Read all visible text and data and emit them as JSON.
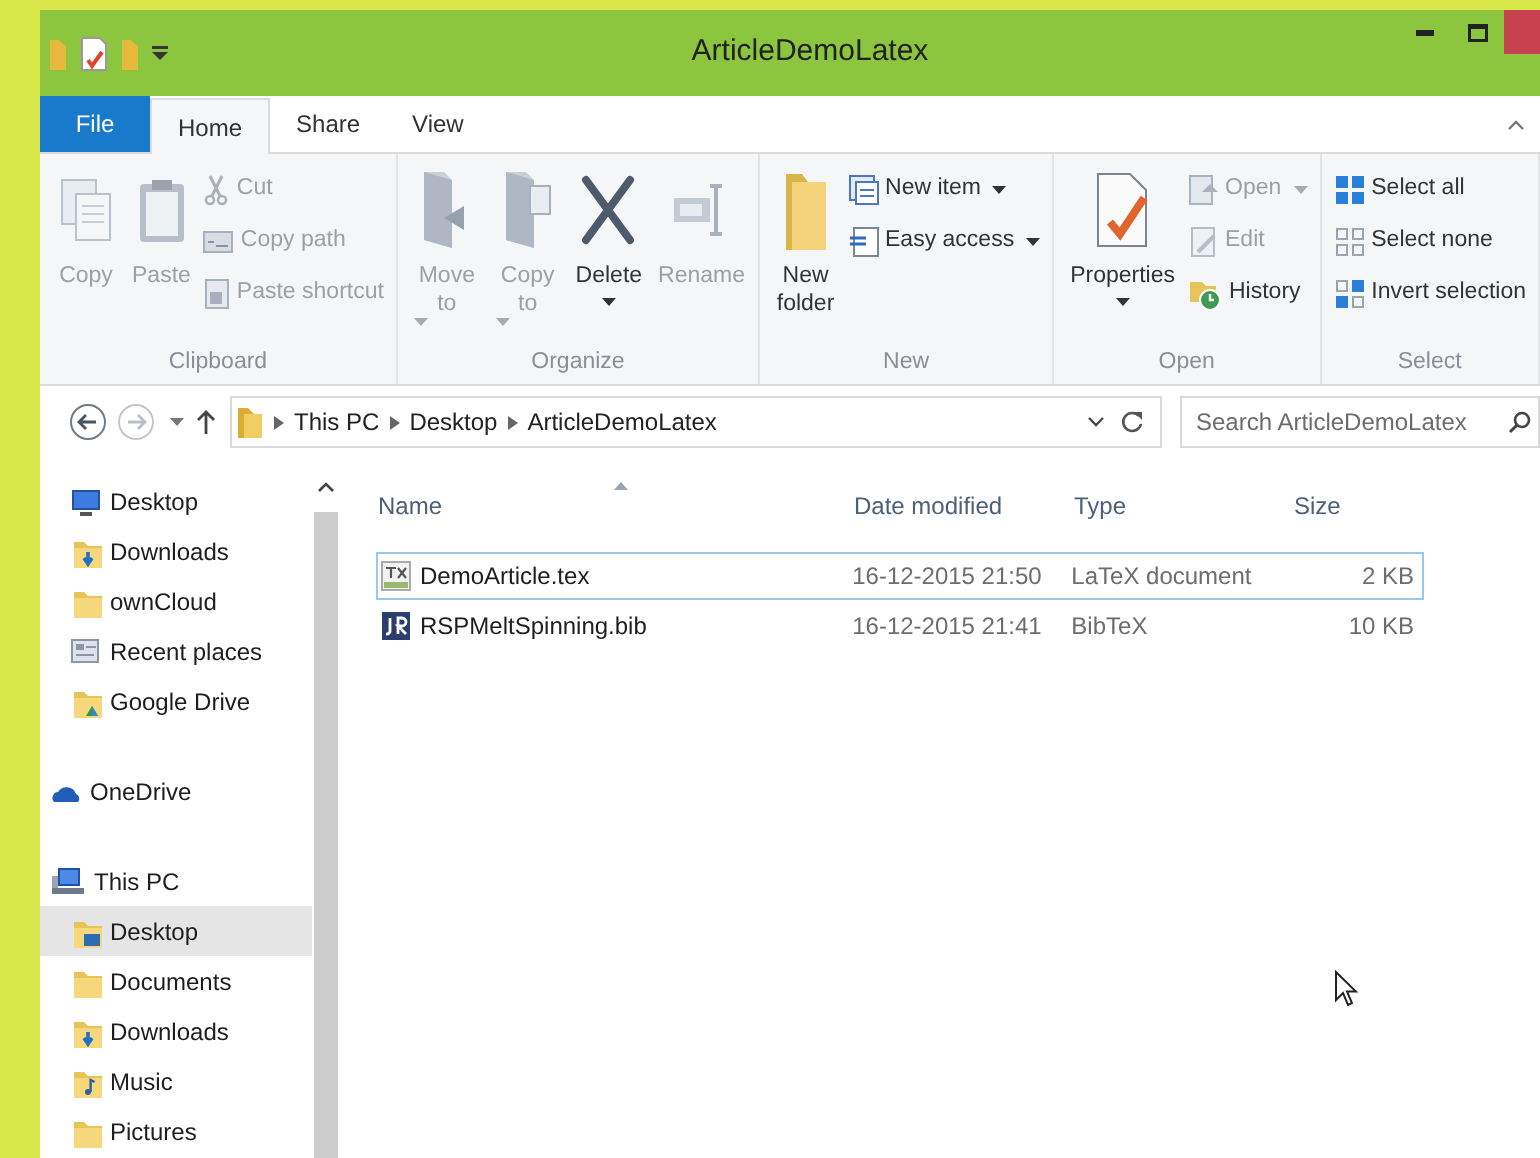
{
  "window": {
    "title": "ArticleDemoLatex"
  },
  "ribbon_tabs": [
    {
      "label": "File",
      "kind": "file",
      "selected": false
    },
    {
      "label": "Home",
      "kind": "tab",
      "selected": true
    },
    {
      "label": "Share",
      "kind": "tab",
      "selected": false
    },
    {
      "label": "View",
      "kind": "tab",
      "selected": false
    }
  ],
  "ribbon_groups": [
    {
      "label": "Clipboard",
      "buttons": [
        {
          "label": "Copy",
          "kind": "large",
          "disabled": true,
          "dropdown": false
        },
        {
          "label": "Paste",
          "kind": "large",
          "disabled": true,
          "dropdown": false
        },
        {
          "label": "Cut",
          "kind": "small",
          "disabled": true,
          "dropdown": false
        },
        {
          "label": "Copy path",
          "kind": "small",
          "disabled": true,
          "dropdown": false
        },
        {
          "label": "Paste shortcut",
          "kind": "small",
          "disabled": true,
          "dropdown": false
        }
      ]
    },
    {
      "label": "Organize",
      "buttons": [
        {
          "label": "Move to",
          "kind": "large",
          "disabled": true,
          "dropdown": true
        },
        {
          "label": "Copy to",
          "kind": "large",
          "disabled": true,
          "dropdown": true
        },
        {
          "label": "Delete",
          "kind": "large",
          "disabled": false,
          "dropdown": true
        },
        {
          "label": "Rename",
          "kind": "large",
          "disabled": true,
          "dropdown": false
        }
      ]
    },
    {
      "label": "New",
      "buttons": [
        {
          "label": "New folder",
          "kind": "large",
          "disabled": false,
          "dropdown": false
        },
        {
          "label": "New item",
          "kind": "small",
          "disabled": false,
          "dropdown": true
        },
        {
          "label": "Easy access",
          "kind": "small",
          "disabled": false,
          "dropdown": true
        }
      ]
    },
    {
      "label": "Open",
      "buttons": [
        {
          "label": "Properties",
          "kind": "large",
          "disabled": false,
          "dropdown": true
        },
        {
          "label": "Open",
          "kind": "small",
          "disabled": true,
          "dropdown": true
        },
        {
          "label": "Edit",
          "kind": "small",
          "disabled": true,
          "dropdown": false
        },
        {
          "label": "History",
          "kind": "small",
          "disabled": false,
          "dropdown": false
        }
      ]
    },
    {
      "label": "Select",
      "buttons": [
        {
          "label": "Select all",
          "kind": "small",
          "disabled": false,
          "dropdown": false
        },
        {
          "label": "Select none",
          "kind": "small",
          "disabled": false,
          "dropdown": false
        },
        {
          "label": "Invert selection",
          "kind": "small",
          "disabled": false,
          "dropdown": false
        }
      ]
    }
  ],
  "address_bar": {
    "path": [
      "This PC",
      "Desktop",
      "ArticleDemoLatex"
    ]
  },
  "search": {
    "placeholder": "Search ArticleDemoLatex"
  },
  "navigation": [
    {
      "label": "Desktop",
      "kind": "monitor",
      "selected": false
    },
    {
      "label": "Downloads",
      "kind": "downloads",
      "selected": false
    },
    {
      "label": "ownCloud",
      "kind": "folder",
      "selected": false
    },
    {
      "label": "Recent places",
      "kind": "recent",
      "selected": false
    },
    {
      "label": "Google Drive",
      "kind": "gdrive",
      "selected": false
    },
    {
      "label": "OneDrive",
      "kind": "cloud",
      "selected": false
    },
    {
      "label": "This PC",
      "kind": "computer",
      "selected": false,
      "children": [
        {
          "label": "Desktop",
          "kind": "desktopfolder",
          "selected": true
        },
        {
          "label": "Documents",
          "kind": "folder",
          "selected": false
        },
        {
          "label": "Downloads",
          "kind": "downloads",
          "selected": false
        },
        {
          "label": "Music",
          "kind": "music",
          "selected": false
        },
        {
          "label": "Pictures",
          "kind": "folder",
          "selected": false
        }
      ]
    }
  ],
  "file_list": {
    "columns": [
      {
        "label": "Name",
        "sorted": true
      },
      {
        "label": "Date modified",
        "sorted": false
      },
      {
        "label": "Type",
        "sorted": false
      },
      {
        "label": "Size",
        "sorted": false
      }
    ],
    "rows": [
      {
        "name": "DemoArticle.tex",
        "kind": "tex",
        "date": "16-12-2015 21:50",
        "type": "LaTeX document",
        "size": "2 KB",
        "focused": true
      },
      {
        "name": "RSPMeltSpinning.bib",
        "kind": "bib",
        "date": "16-12-2015 21:41",
        "type": "BibTeX",
        "size": "10 KB",
        "focused": false
      }
    ]
  }
}
